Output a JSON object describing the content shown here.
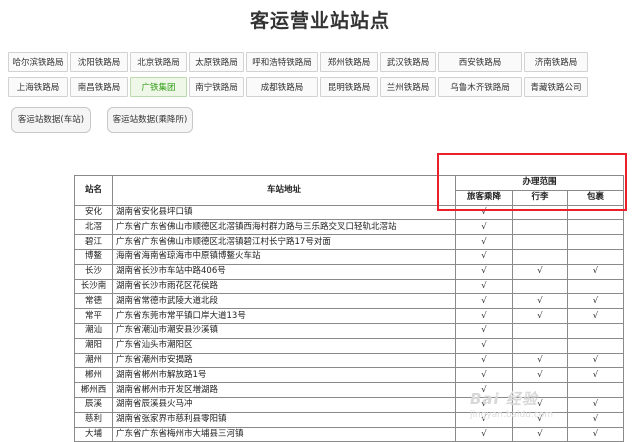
{
  "page": {
    "title": "客运营业站站点"
  },
  "bureau_rows": [
    [
      "哈尔滨铁路局",
      "沈阳铁路局",
      "北京铁路局",
      "太原铁路局",
      "呼和浩特铁路局",
      "郑州铁路局",
      "武汉铁路局",
      "西安铁路局",
      "济南铁路局"
    ],
    [
      "上海铁路局",
      "南昌铁路局",
      "广铁集团",
      "南宁铁路局",
      "成都铁路局",
      "昆明铁路局",
      "兰州铁路局",
      "乌鲁木齐铁路局",
      "青藏铁路公司"
    ]
  ],
  "active_bureau": "广铁集团",
  "data_buttons": [
    "客运站数据(车站)",
    "客运站数据(乘降所)"
  ],
  "table": {
    "col_station": "站名",
    "col_address": "车站地址",
    "col_scope": "办理范围",
    "sub_headers": [
      "旅客乘降",
      "行李",
      "包裹"
    ],
    "check": "√",
    "rows": [
      {
        "name": "安化",
        "addr": "湖南省安化县坪口镇",
        "svc": [
          1,
          0,
          0
        ]
      },
      {
        "name": "北滘",
        "addr": "广东省广东省佛山市顺德区北滘镇西海村群力路与三乐路交叉口轻轨北滘站",
        "svc": [
          1,
          0,
          0
        ]
      },
      {
        "name": "碧江",
        "addr": "广东省广东省佛山市顺德区北滘镇碧江村长宁路17号对面",
        "svc": [
          1,
          0,
          0
        ]
      },
      {
        "name": "博鳌",
        "addr": "海南省海南省琼海市中原镇博鳌火车站",
        "svc": [
          1,
          0,
          0
        ]
      },
      {
        "name": "长沙",
        "addr": "湖南省长沙市车站中路406号",
        "svc": [
          1,
          1,
          1
        ]
      },
      {
        "name": "长沙南",
        "addr": "湖南省长沙市雨花区花侯路",
        "svc": [
          1,
          0,
          0
        ]
      },
      {
        "name": "常德",
        "addr": "湖南省常德市武陵大道北段",
        "svc": [
          1,
          1,
          1
        ]
      },
      {
        "name": "常平",
        "addr": "广东省东莞市常平镇口岸大道13号",
        "svc": [
          1,
          1,
          1
        ]
      },
      {
        "name": "潮汕",
        "addr": "广东省潮汕市潮安县沙溪镇",
        "svc": [
          1,
          0,
          0
        ]
      },
      {
        "name": "潮阳",
        "addr": "广东省汕头市潮阳区",
        "svc": [
          1,
          0,
          0
        ]
      },
      {
        "name": "潮州",
        "addr": "广东省潮州市安揭路",
        "svc": [
          1,
          1,
          1
        ]
      },
      {
        "name": "郴州",
        "addr": "湖南省郴州市解放路1号",
        "svc": [
          1,
          1,
          1
        ]
      },
      {
        "name": "郴州西",
        "addr": "湖南省郴州市开发区増湖路",
        "svc": [
          1,
          0,
          0
        ]
      },
      {
        "name": "辰溪",
        "addr": "湖南省辰溪县火马冲",
        "svc": [
          1,
          1,
          1
        ]
      },
      {
        "name": "慈利",
        "addr": "湖南省张家界市慈利县零阳镇",
        "svc": [
          1,
          1,
          1
        ]
      },
      {
        "name": "大埔",
        "addr": "广东省广东省梅州市大埔县三河镇",
        "svc": [
          1,
          1,
          1
        ]
      }
    ]
  },
  "watermark": {
    "text": "Bai 经验",
    "sub": "jingyan.baidu.com"
  }
}
